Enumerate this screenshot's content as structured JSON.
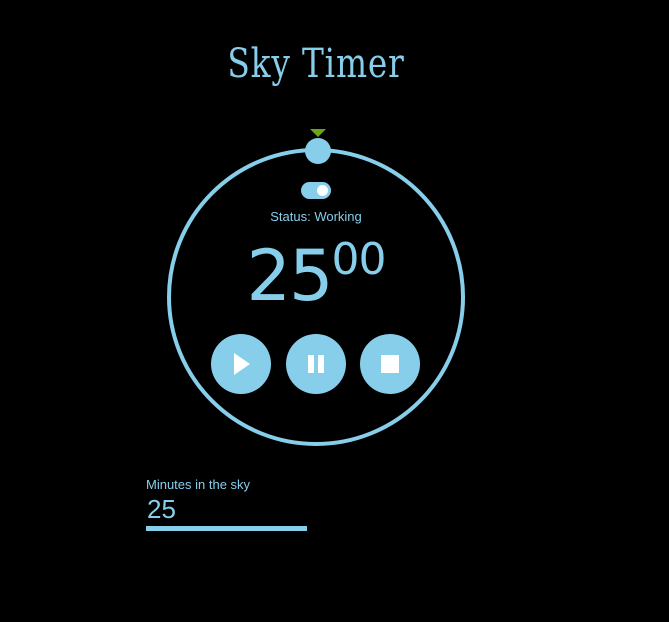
{
  "app": {
    "title": "Sky Timer"
  },
  "timer": {
    "mode_toggle_on": true,
    "status_text": "Status: Working",
    "minutes": "25",
    "seconds": "00",
    "progress": 0
  },
  "controls": {
    "play_icon": "play-icon",
    "pause_icon": "pause-icon",
    "stop_icon": "stop-icon"
  },
  "settings": {
    "minutes_label": "Minutes in the sky",
    "minutes_value": "25"
  },
  "colors": {
    "accent": "#87ceeb",
    "background": "#000000",
    "marker": "#6aa61a"
  }
}
